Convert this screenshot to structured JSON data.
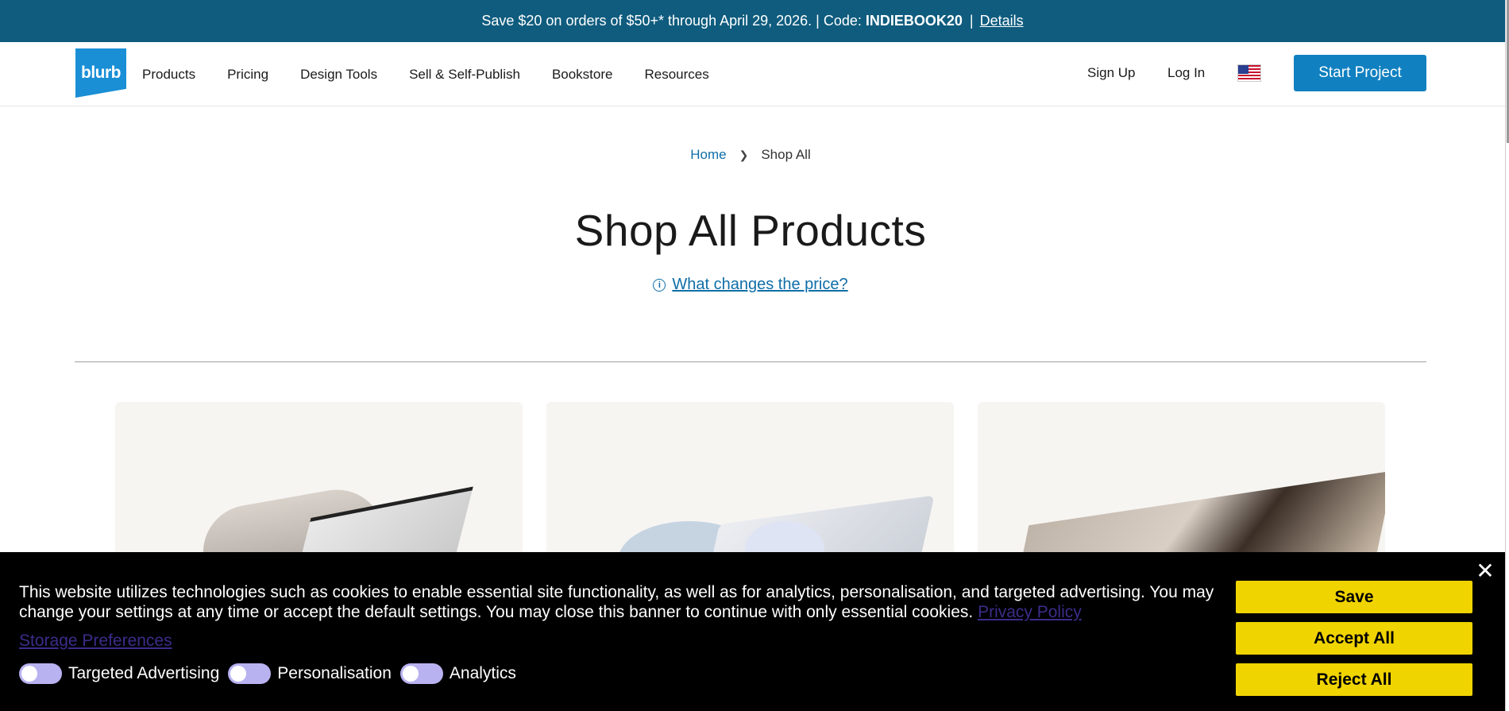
{
  "promo": {
    "text": "Save $20 on orders of $50+* through April 29, 2026. | Code:",
    "code": "INDIEBOOK20",
    "separator": "|",
    "details": "Details"
  },
  "header": {
    "logo": "blurb",
    "nav": [
      "Products",
      "Pricing",
      "Design Tools",
      "Sell & Self-Publish",
      "Bookstore",
      "Resources"
    ],
    "sign_up": "Sign Up",
    "log_in": "Log In",
    "flag_icon": "us-flag-icon",
    "start_project": "Start Project"
  },
  "breadcrumb": {
    "home": "Home",
    "current": "Shop All"
  },
  "page": {
    "title": "Shop All Products",
    "price_link": "What changes the price?"
  },
  "cookie_banner": {
    "message": "This website utilizes technologies such as cookies to enable essential site functionality, as well as for analytics, personalisation, and targeted advertising. You may change your settings at any time or accept the default settings. You may close this banner to continue with only essential cookies.",
    "privacy_policy": "Privacy Policy",
    "storage_preferences": "Storage Preferences",
    "toggles": [
      "Targeted Advertising",
      "Personalisation",
      "Analytics"
    ],
    "save": "Save",
    "accept_all": "Accept All",
    "reject_all": "Reject All",
    "close_icon": "close-icon"
  },
  "colors": {
    "promo_bg": "#0f5c7e",
    "primary_button": "#1080c0",
    "link": "#0f6ea8",
    "cookie_button": "#f0d400",
    "toggle": "#b9b2f1"
  }
}
